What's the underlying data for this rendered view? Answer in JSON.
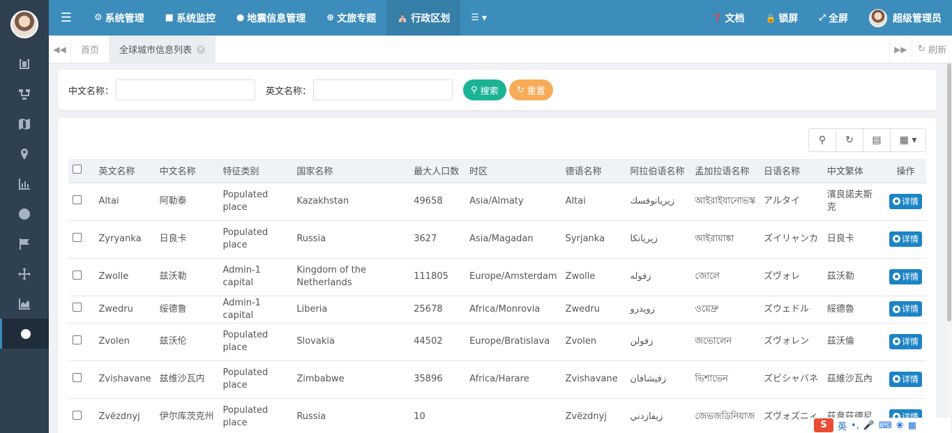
{
  "top_nav": {
    "items": [
      {
        "icon": "gear-icon",
        "label": "系统管理"
      },
      {
        "icon": "video-icon",
        "label": "系统监控"
      },
      {
        "icon": "map-marker-icon",
        "label": "地震信息管理"
      },
      {
        "icon": "globe-icon",
        "label": "文旅专题"
      },
      {
        "icon": "bank-icon",
        "label": "行政区划"
      },
      {
        "icon": "list-icon",
        "label": ""
      }
    ],
    "right": {
      "docs_label": "文档",
      "lock_label": "锁屏",
      "fullscreen_label": "全屏",
      "user_label": "超级管理员"
    }
  },
  "tabs": {
    "home": "首页",
    "current": "全球城市信息列表",
    "refresh": "刷新"
  },
  "search": {
    "cn_label": "中文名称：",
    "en_label": "英文名称：",
    "search_btn": "搜索",
    "reset_btn": "重置"
  },
  "table": {
    "headers": [
      "英文名称",
      "中文名称",
      "特征类别",
      "国家名称",
      "最大人口数",
      "时区",
      "德语名称",
      "阿拉伯语名称",
      "孟加拉语名称",
      "日语名称",
      "中文繁体",
      "操作"
    ],
    "detail_label": "详情",
    "rows": [
      {
        "en": "Altai",
        "cn": "阿勒泰",
        "feature": "Populated place",
        "country": "Kazakhstan",
        "pop": "49658",
        "tz": "Asia/Almaty",
        "de": "Altai",
        "ar": "زيريانوفسك",
        "bn": "আইরাইযানোভস্ক",
        "ja": "アルタイ",
        "tw": "濱良諾夫斯克"
      },
      {
        "en": "Zyryanka",
        "cn": "日良卡",
        "feature": "Populated place",
        "country": "Russia",
        "pop": "3627",
        "tz": "Asia/Magadan",
        "de": "Syrjanka",
        "ar": "زيريانكا",
        "bn": "আইরায়াঙ্কা",
        "ja": "ズイリャンカ",
        "tw": "日良卡"
      },
      {
        "en": "Zwolle",
        "cn": "兹沃勒",
        "feature": "Admin-1 capital",
        "country": "Kingdom of the Netherlands",
        "pop": "111805",
        "tz": "Europe/Amsterdam",
        "de": "Zwolle",
        "ar": "زفوله",
        "bn": "জোলে",
        "ja": "ズヴォレ",
        "tw": "茲沃勒"
      },
      {
        "en": "Zwedru",
        "cn": "绥德鲁",
        "feature": "Admin-1 capital",
        "country": "Liberia",
        "pop": "25678",
        "tz": "Africa/Monrovia",
        "de": "Zwedru",
        "ar": "زويدرو",
        "bn": "ওয়েদ্রু",
        "ja": "ズウェドル",
        "tw": "綏德魯"
      },
      {
        "en": "Zvolen",
        "cn": "兹沃伦",
        "feature": "Populated place",
        "country": "Slovakia",
        "pop": "44502",
        "tz": "Europe/Bratislava",
        "de": "Zvolen",
        "ar": "زفولن",
        "bn": "জভোলেন",
        "ja": "ズヴォレン",
        "tw": "茲沃倫"
      },
      {
        "en": "Zvishavane",
        "cn": "兹维沙瓦内",
        "feature": "Populated place",
        "country": "Zimbabwe",
        "pop": "35896",
        "tz": "Africa/Harare",
        "de": "Zvishavane",
        "ar": "زفيشافان",
        "bn": "ভিশাভেন",
        "ja": "ズビシャバネ",
        "tw": "茲維沙瓦內"
      },
      {
        "en": "Zvëzdnyj",
        "cn": "伊尔库茨克州",
        "feature": "Populated place",
        "country": "Russia",
        "pop": "10",
        "tz": "",
        "de": "Zvëzdnyj",
        "ar": "زيفازدني",
        "bn": "জেভজডিনিয়াজ",
        "ja": "ズヴォズニィ",
        "tw": "茲韋茲德尼"
      }
    ]
  },
  "ime": {
    "lang": "英"
  }
}
